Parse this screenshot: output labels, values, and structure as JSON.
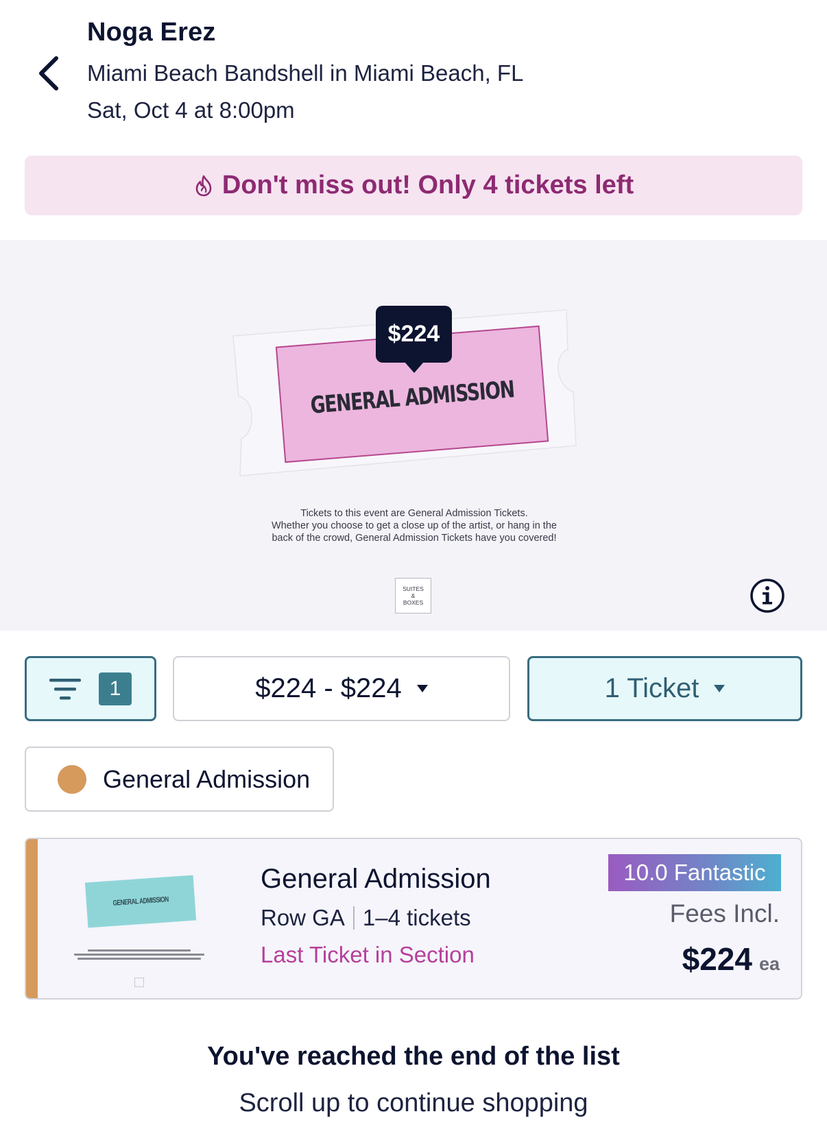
{
  "header": {
    "title": "Noga Erez",
    "venue": "Miami Beach Bandshell in Miami Beach, FL",
    "date": "Sat, Oct 4 at 8:00pm",
    "back_icon": "chevron-left-icon"
  },
  "banner": {
    "icon": "flame-icon",
    "text": "Don't miss out! Only 4 tickets left"
  },
  "map": {
    "price_pin": "$224",
    "section_label": "GENERAL ADMISSION",
    "description_lines": [
      "Tickets to this event are General Admission Tickets.",
      "Whether you choose to get a close up of the artist, or hang in the",
      "back of the crowd, General Admission Tickets have you covered!"
    ],
    "suites_lines": [
      "SUITES",
      "&",
      "BOXES"
    ],
    "info_icon": "info-icon"
  },
  "filters": {
    "filter_icon": "filter-lines-icon",
    "filter_count": "1",
    "price_range": "$224 - $224",
    "quantity": "1 Ticket"
  },
  "section_chip": {
    "label": "General Admission",
    "dot_color": "#d59a5c"
  },
  "listing": {
    "thumb_label": "GENERAL ADMISSION",
    "title": "General Admission",
    "row": "Row GA",
    "qty_range": "1–4 tickets",
    "note": "Last Ticket in Section",
    "rating": "10.0 Fantastic",
    "fees": "Fees Incl.",
    "price": "$224",
    "price_unit": "ea"
  },
  "end_of_list": {
    "title": "You've reached the end of the list",
    "subtitle": "Scroll up to continue shopping"
  },
  "colors": {
    "navy": "#0d1430",
    "banner_bg": "#f6e4f1",
    "banner_text": "#8e2a72",
    "ga_fill": "#ecb6de",
    "teal_border": "#3a6d80",
    "teal_fill": "#e6f8fa",
    "accent_orange": "#d59a5c",
    "note_pink": "#b6409a"
  }
}
